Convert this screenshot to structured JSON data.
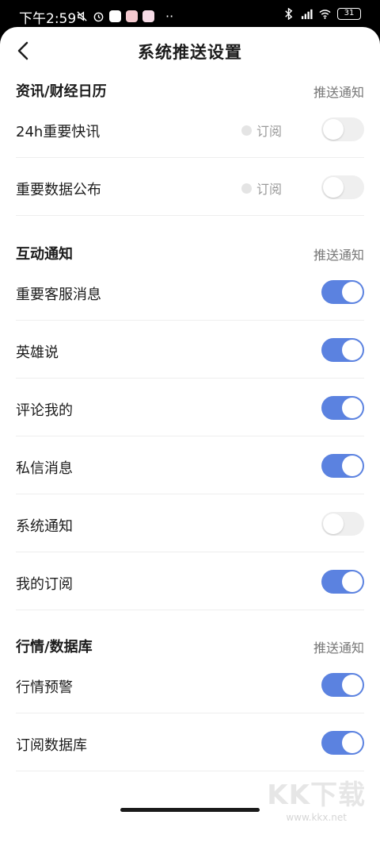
{
  "status_bar": {
    "time": "下午2:59",
    "battery": "31"
  },
  "nav": {
    "title": "系统推送设置"
  },
  "colors": {
    "accent": "#5b82e0",
    "toggle_off": "#efefef",
    "divider": "#eeeeee"
  },
  "sections": [
    {
      "title": "资讯/财经日历",
      "right_label": "推送通知",
      "rows": [
        {
          "label": "24h重要快讯",
          "subscribe": "订阅",
          "enabled": false
        },
        {
          "label": "重要数据公布",
          "subscribe": "订阅",
          "enabled": false
        }
      ]
    },
    {
      "title": "互动通知",
      "right_label": "推送通知",
      "rows": [
        {
          "label": "重要客服消息",
          "enabled": true
        },
        {
          "label": "英雄说",
          "enabled": true
        },
        {
          "label": "评论我的",
          "enabled": true
        },
        {
          "label": "私信消息",
          "enabled": true
        },
        {
          "label": "系统通知",
          "enabled": false
        },
        {
          "label": "我的订阅",
          "enabled": true
        }
      ]
    },
    {
      "title": "行情/数据库",
      "right_label": "推送通知",
      "rows": [
        {
          "label": "行情预警",
          "enabled": true
        },
        {
          "label": "订阅数据库",
          "enabled": true
        }
      ]
    }
  ],
  "watermark": {
    "brand": "KK下载",
    "url": "www.kkx.net"
  }
}
